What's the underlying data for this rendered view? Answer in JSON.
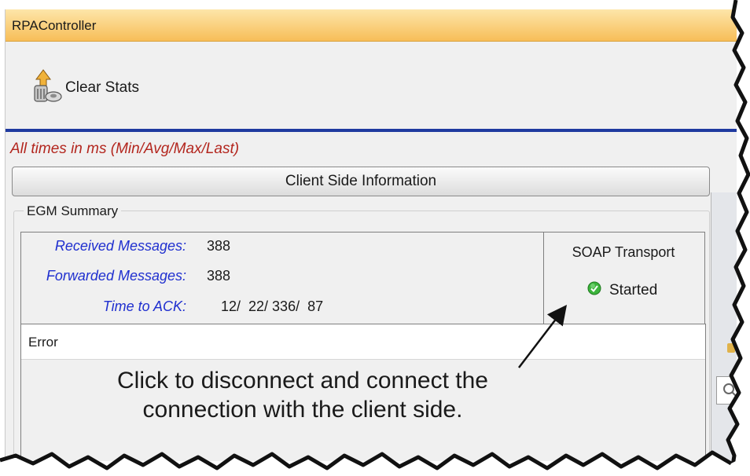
{
  "window": {
    "title": "RPAController"
  },
  "toolbar": {
    "clear_stats_label": "Clear Stats",
    "clear_stats_icon": "clear-stats-icon"
  },
  "note": {
    "text": "All times in ms (Min/Avg/Max/Last)",
    "color": "#b3261e"
  },
  "client_side_button": {
    "label": "Client Side Information"
  },
  "egm_summary": {
    "title": "EGM Summary",
    "stats": [
      {
        "label": "Received Messages:",
        "value": "388"
      },
      {
        "label": "Forwarded Messages:",
        "value": "388"
      },
      {
        "label": "Time to ACK:",
        "value": "12/  22/ 336/  87"
      }
    ],
    "label_color": "#1f2fcf"
  },
  "soap_transport": {
    "title": "SOAP Transport",
    "status": "Started",
    "status_icon": "green-check-icon",
    "status_color": "#3cb43c"
  },
  "error_panel": {
    "header": "Error"
  },
  "callout": {
    "line1": "Click to disconnect and connect the",
    "line2": "connection with the client side."
  }
}
